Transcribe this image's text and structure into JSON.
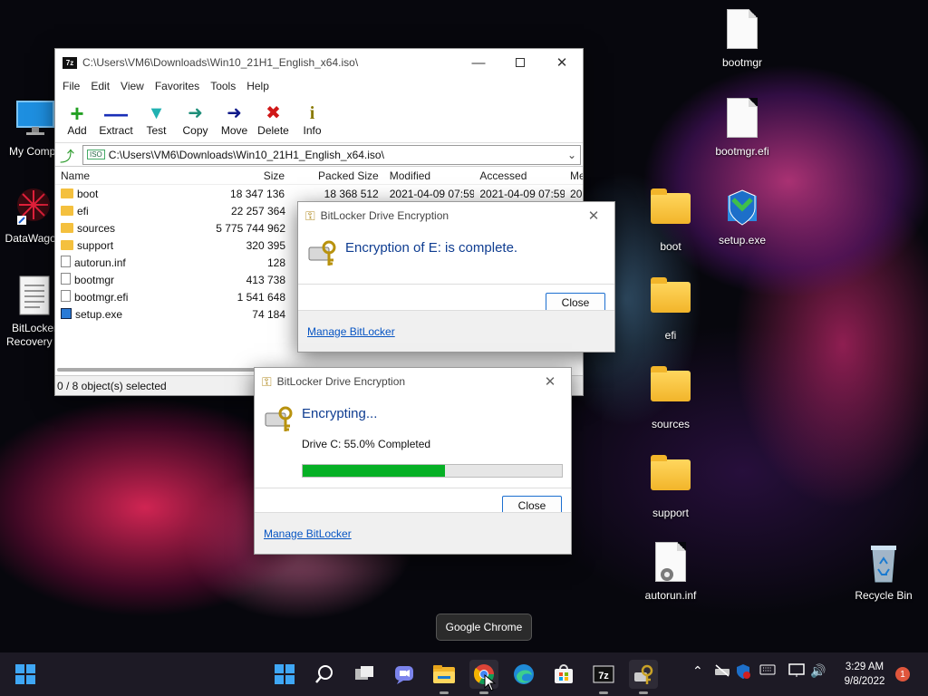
{
  "desktop": {
    "icons_left": [
      {
        "label": "My Compu",
        "icon": "monitor-icon"
      },
      {
        "label": "DataWagon",
        "icon": "datawagon-icon"
      },
      {
        "label": "BitLocker Recovery K",
        "icon": "text-file-icon"
      }
    ],
    "icons_right": [
      {
        "label": "bootmgr",
        "icon": "file-icon"
      },
      {
        "label": "bootmgr.efi",
        "icon": "file-icon"
      },
      {
        "label": "boot",
        "icon": "folder-icon"
      },
      {
        "label": "setup.exe",
        "icon": "setup-icon"
      },
      {
        "label": "efi",
        "icon": "folder-icon"
      },
      {
        "label": "sources",
        "icon": "folder-icon"
      },
      {
        "label": "support",
        "icon": "folder-icon"
      },
      {
        "label": "autorun.inf",
        "icon": "settings-file-icon"
      },
      {
        "label": "Recycle Bin",
        "icon": "recycle-bin-icon"
      }
    ]
  },
  "zip": {
    "title": "C:\\Users\\VM6\\Downloads\\Win10_21H1_English_x64.iso\\",
    "menu": [
      "File",
      "Edit",
      "View",
      "Favorites",
      "Tools",
      "Help"
    ],
    "toolbar": [
      {
        "label": "Add",
        "icon": "plus-icon",
        "color": "#22a022"
      },
      {
        "label": "Extract",
        "icon": "minus-icon",
        "color": "#1a2fb8"
      },
      {
        "label": "Test",
        "icon": "test-check-icon",
        "color": "#21b2b2"
      },
      {
        "label": "Copy",
        "icon": "copy-arrow-icon",
        "color": "#1f8f7a"
      },
      {
        "label": "Move",
        "icon": "move-arrow-icon",
        "color": "#101a8a"
      },
      {
        "label": "Delete",
        "icon": "delete-x-icon",
        "color": "#d01818"
      },
      {
        "label": "Info",
        "icon": "info-icon",
        "color": "#8a7a00"
      }
    ],
    "address": "C:\\Users\\VM6\\Downloads\\Win10_21H1_English_x64.iso\\",
    "address_badge": "ISO",
    "columns": {
      "name": "Name",
      "size": "Size",
      "packed": "Packed Size",
      "modified": "Modified",
      "accessed": "Accessed",
      "more": "Me"
    },
    "rows": [
      {
        "name": "boot",
        "type": "folder",
        "size": "18 347 136",
        "packed": "18 368 512",
        "modified": "2021-04-09 07:59",
        "accessed": "2021-04-09 07:59",
        "more": "20"
      },
      {
        "name": "efi",
        "type": "folder",
        "size": "22 257 364",
        "packed": "",
        "modified": "",
        "accessed": "",
        "more": ""
      },
      {
        "name": "sources",
        "type": "folder",
        "size": "5 775 744 962",
        "packed": "",
        "modified": "",
        "accessed": "",
        "more": ""
      },
      {
        "name": "support",
        "type": "folder",
        "size": "320 395",
        "packed": "",
        "modified": "",
        "accessed": "",
        "more": ""
      },
      {
        "name": "autorun.inf",
        "type": "file",
        "size": "128",
        "packed": "",
        "modified": "",
        "accessed": "",
        "more": ""
      },
      {
        "name": "bootmgr",
        "type": "file",
        "size": "413 738",
        "packed": "",
        "modified": "",
        "accessed": "",
        "more": ""
      },
      {
        "name": "bootmgr.efi",
        "type": "file",
        "size": "1 541 648",
        "packed": "",
        "modified": "",
        "accessed": "",
        "more": ""
      },
      {
        "name": "setup.exe",
        "type": "exe",
        "size": "74 184",
        "packed": "",
        "modified": "",
        "accessed": "",
        "more": ""
      }
    ],
    "status": "0 / 8 object(s) selected"
  },
  "bitlocker_complete": {
    "title": "BitLocker Drive Encryption",
    "heading": "Encryption of E: is complete.",
    "close_label": "Close",
    "link": "Manage BitLocker"
  },
  "bitlocker_progress": {
    "title": "BitLocker Drive Encryption",
    "heading": "Encrypting...",
    "detail": "Drive C: 55.0% Completed",
    "progress_fraction": 0.55,
    "progress_color": "#06b025",
    "close_label": "Close",
    "link": "Manage BitLocker"
  },
  "tooltip": "Google Chrome",
  "taskbar": {
    "clock_time": "3:29 AM",
    "clock_date": "9/8/2022",
    "notification_count": "1"
  }
}
